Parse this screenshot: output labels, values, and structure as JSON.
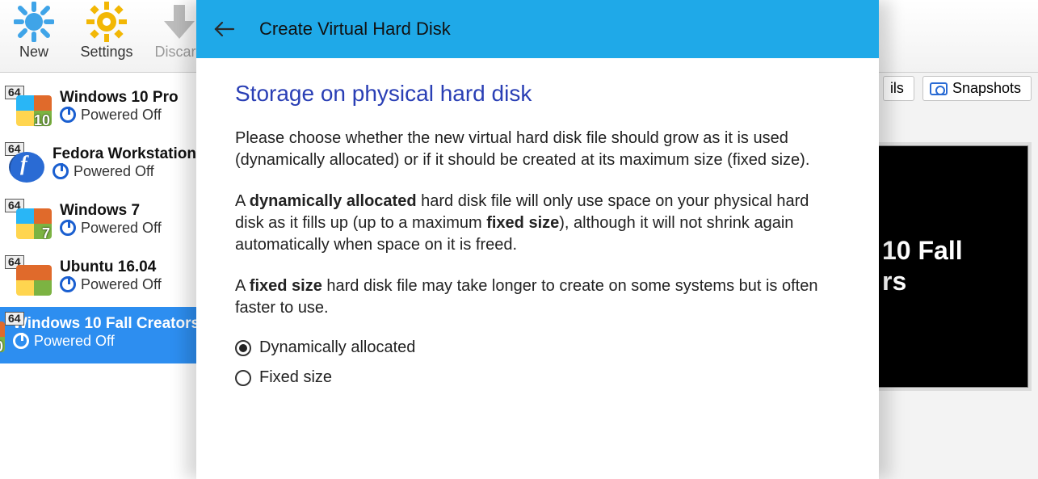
{
  "toolbar": {
    "items": [
      {
        "label": "New"
      },
      {
        "label": "Settings"
      },
      {
        "label": "Discard",
        "disabled": true
      }
    ]
  },
  "sidebar": {
    "vms": [
      {
        "name": "Windows 10 Pro",
        "state": "Powered Off",
        "os": "win",
        "num": "10",
        "selected": false
      },
      {
        "name": "Fedora Workstation",
        "state": "Powered Off",
        "os": "fedora",
        "num": "",
        "selected": false
      },
      {
        "name": "Windows 7",
        "state": "Powered Off",
        "os": "win",
        "num": "7",
        "selected": false
      },
      {
        "name": "Ubuntu 16.04",
        "state": "Powered Off",
        "os": "ubuntu",
        "num": "",
        "selected": false
      },
      {
        "name": "Windows 10 Fall Creators",
        "state": "Powered Off",
        "os": "win",
        "num": "10",
        "selected": true
      }
    ]
  },
  "right": {
    "tabs": {
      "details_suffix": "ils",
      "snapshots": "Snapshots"
    },
    "preview_line1": "10 Fall",
    "preview_line2": "rs"
  },
  "dialog": {
    "title": "Create Virtual Hard Disk",
    "heading": "Storage on physical hard disk",
    "p1": "Please choose whether the new virtual hard disk file should grow as it is used (dynamically allocated) or if it should be created at its maximum size (fixed size).",
    "p2a": "A ",
    "p2b": "dynamically allocated",
    "p2c": " hard disk file will only use space on your physical hard disk as it fills up (up to a maximum ",
    "p2d": "fixed size",
    "p2e": "), although it will not shrink again automatically when space on it is freed.",
    "p3a": "A ",
    "p3b": "fixed size",
    "p3c": " hard disk file may take longer to create on some systems but is often faster to use.",
    "radios": [
      {
        "label": "Dynamically allocated",
        "checked": true
      },
      {
        "label": "Fixed size",
        "checked": false
      }
    ]
  }
}
